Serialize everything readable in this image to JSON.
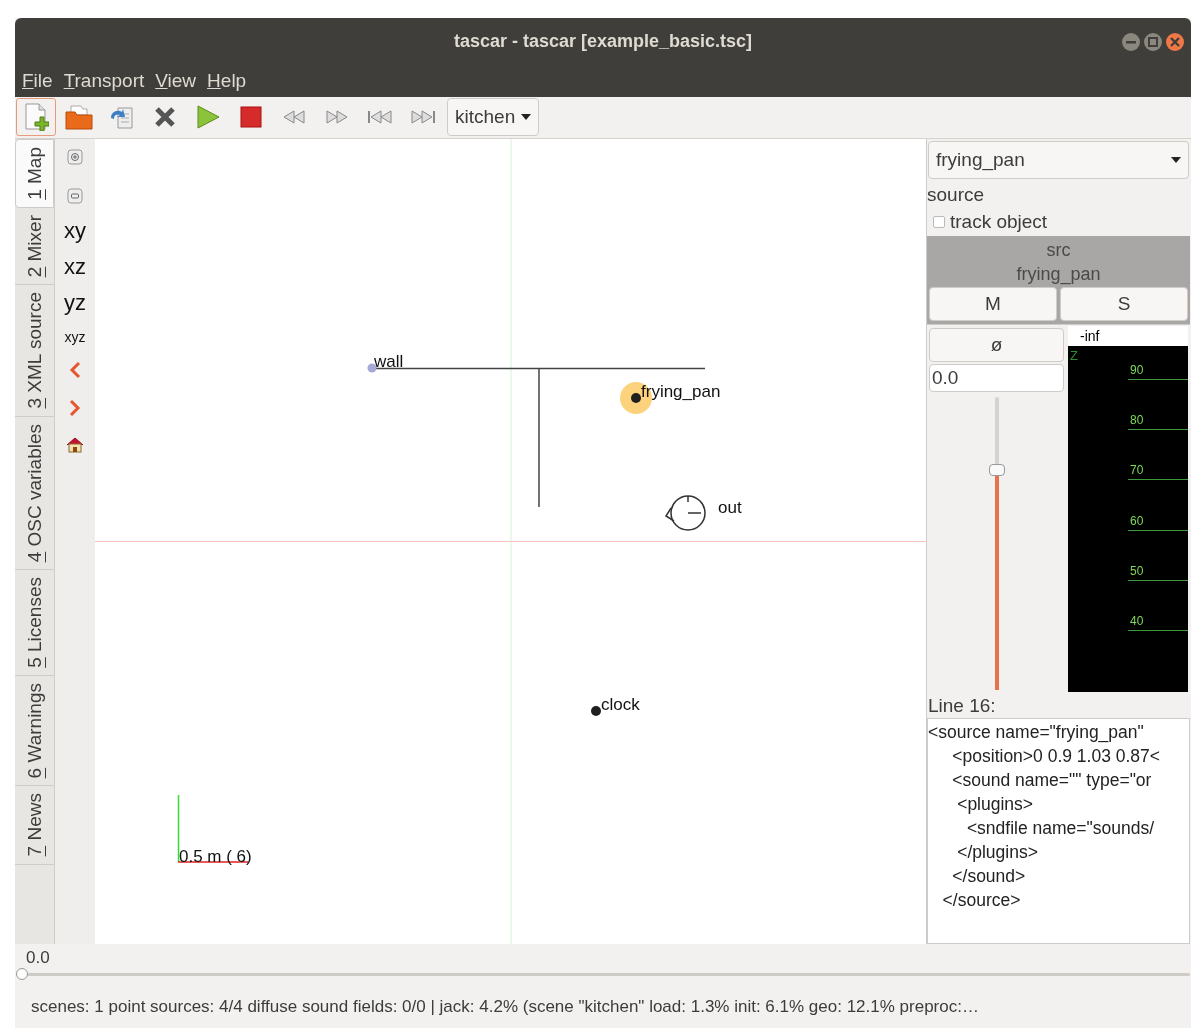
{
  "window": {
    "title": "tascar - tascar [example_basic.tsc]"
  },
  "menu": [
    {
      "label": "File"
    },
    {
      "label": "Transport"
    },
    {
      "label": "View"
    },
    {
      "label": "Help"
    }
  ],
  "toolbar": {
    "scene_select": "kitchen"
  },
  "side_tabs": [
    {
      "label": "1 Map",
      "selected": true
    },
    {
      "label": "2 Mixer",
      "selected": false
    },
    {
      "label": "3 XML source",
      "selected": false
    },
    {
      "label": "4 OSC variables",
      "selected": false
    },
    {
      "label": "5 Licenses",
      "selected": false
    },
    {
      "label": "6 Warnings",
      "selected": false
    },
    {
      "label": "7 News",
      "selected": false
    }
  ],
  "map_tools": [
    {
      "kind": "zoom_in"
    },
    {
      "kind": "zoom_out"
    },
    {
      "kind": "text",
      "label": "xy"
    },
    {
      "kind": "text",
      "label": "xz"
    },
    {
      "kind": "text",
      "label": "yz"
    },
    {
      "kind": "small_text",
      "label": "xyz"
    },
    {
      "kind": "prev"
    },
    {
      "kind": "next"
    },
    {
      "kind": "home"
    }
  ],
  "map": {
    "objects": [
      {
        "kind": "wall",
        "label": "wall",
        "selected": false
      },
      {
        "kind": "source",
        "label": "frying_pan",
        "selected": true
      },
      {
        "kind": "receiver",
        "label": "out",
        "selected": false
      },
      {
        "kind": "source",
        "label": "clock",
        "selected": false
      }
    ],
    "scale_label": "0.5 m ( 6)"
  },
  "object_panel": {
    "object_select": "frying_pan",
    "object_type": "source",
    "track_object": {
      "label": "track object",
      "checked": false
    },
    "strip": {
      "header": [
        "src",
        "frying_pan"
      ],
      "mute": {
        "label": "M",
        "on": false
      },
      "solo": {
        "label": "S",
        "on": false
      },
      "phase": {
        "label": "ø",
        "on": false
      },
      "gain": "0.0",
      "fader": {
        "level": 0.75
      },
      "meter": {
        "reading": "-inf",
        "channel": "Z",
        "scale": [
          "90",
          "80",
          "70",
          "60",
          "50",
          "40"
        ]
      }
    }
  },
  "xml": {
    "title": "Line 16:",
    "lines": [
      "<source name=\"frying_pan\"",
      "     <position>0 0.9 1.03 0.87<",
      "     <sound name=\"\" type=\"or",
      "      <plugins>",
      "        <sndfile name=\"sounds/",
      "      </plugins>",
      "     </sound>",
      "   </source>"
    ]
  },
  "time": {
    "value": "0.0",
    "slider": {
      "level": 0
    }
  },
  "status_bar": "scenes: 1  point sources: 4/4  diffuse sound fields: 0/0 | jack: 4.2% (scene \"kitchen\" load: 1.3% init: 6.1%  geo: 12.1%  preproc:…"
}
